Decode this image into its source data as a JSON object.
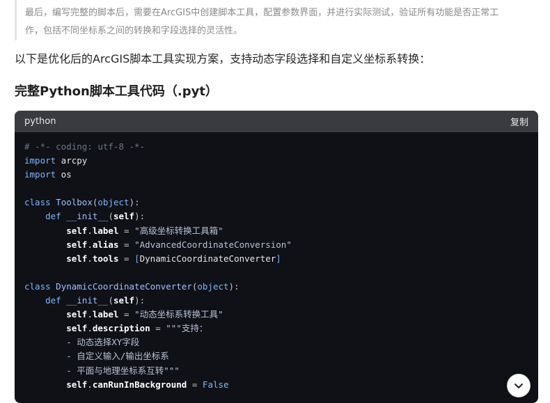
{
  "quote": {
    "line1": "最后，编写完整的脚本后，需要在ArcGIS中创建脚本工具，配置参数界面，并进行实际测试，验证所有功能是否正常工",
    "line2": "作，包括不同坐标系之间的转换和字段选择的灵活性。"
  },
  "intro": "以下是优化后的ArcGIS脚本工具实现方案，支持动态字段选择和自定义坐标系转换：",
  "heading": "完整Python脚本工具代码（.pyt）",
  "code_block": {
    "language": "python",
    "copy_label": "复制",
    "lines": [
      "# -*- coding: utf-8 -*-",
      "import arcpy",
      "import os",
      "",
      "class Toolbox(object):",
      "    def __init__(self):",
      "        self.label = \"高级坐标转换工具箱\"",
      "        self.alias = \"AdvancedCoordinateConversion\"",
      "        self.tools = [DynamicCoordinateConverter]",
      "",
      "class DynamicCoordinateConverter(object):",
      "    def __init__(self):",
      "        self.label = \"动态坐标系转换工具\"",
      "        self.description = \"\"\"支持：",
      "        - 动态选择XY字段",
      "        - 自定义输入/输出坐标系",
      "        - 平面与地理坐标系互转\"\"\"",
      "        self.canRunInBackground = False"
    ]
  },
  "scroll_button": {
    "icon": "chevron-down-icon"
  },
  "colors": {
    "code_bg": "#0f1117",
    "code_header_bg": "#3a3b40",
    "keyword": "#7ab7ff"
  }
}
